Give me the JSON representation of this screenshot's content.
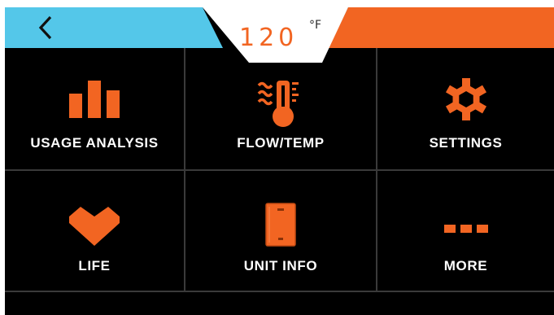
{
  "header": {
    "back_icon": "chevron-left-icon",
    "temperature_value": "120",
    "temperature_unit": "°F",
    "colors": {
      "left_bar": "#54c7e9",
      "right_bar": "#f26522",
      "center_panel": "#ffffff"
    }
  },
  "menu": {
    "tiles": [
      {
        "label": "USAGE ANALYSIS",
        "icon": "bar-chart-icon"
      },
      {
        "label": "FLOW/TEMP",
        "icon": "thermometer-flow-icon"
      },
      {
        "label": "SETTINGS",
        "icon": "gear-icon"
      },
      {
        "label": "LIFE",
        "icon": "heart-icon"
      },
      {
        "label": "UNIT INFO",
        "icon": "water-heater-unit-icon"
      },
      {
        "label": "MORE",
        "icon": "more-dots-icon"
      }
    ]
  },
  "colors": {
    "accent": "#f26522",
    "background": "#000000",
    "text": "#ffffff",
    "grid_lines": "#3a3a3a"
  }
}
